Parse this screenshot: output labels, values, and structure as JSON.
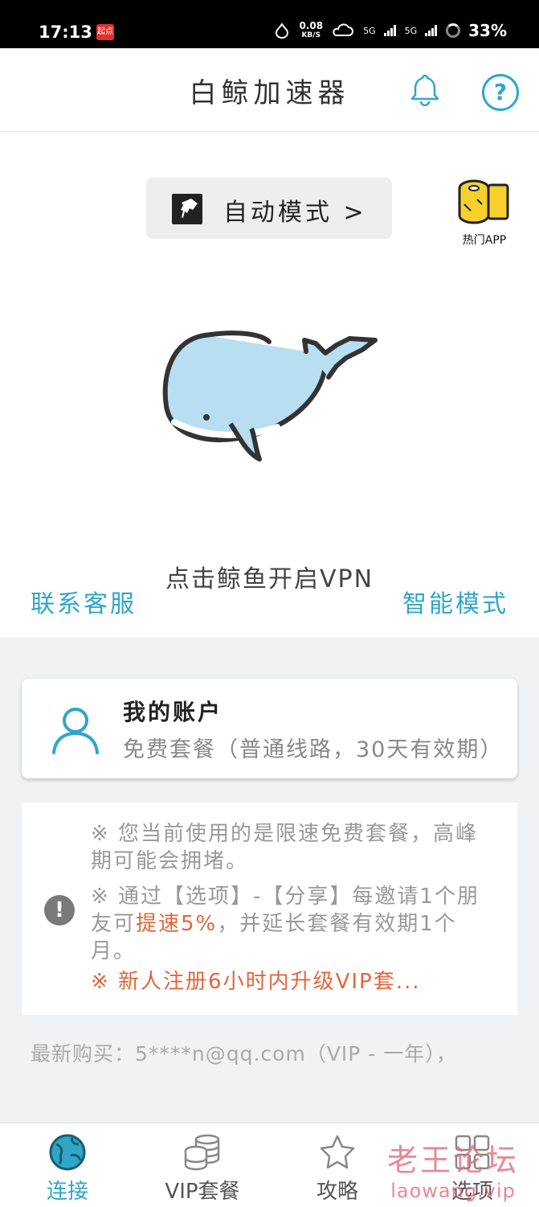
{
  "status_bar": {
    "time": "17:13",
    "app_badge": "起点",
    "net_speed": "0.08",
    "net_unit": "KB/S",
    "signal1": "5G",
    "signal2": "5G",
    "battery": "33%"
  },
  "header": {
    "title": "白鲸加速器"
  },
  "mode_button": {
    "label": "自动模式 >"
  },
  "hot_app": {
    "label": "热门APP"
  },
  "main": {
    "tap_hint": "点击鲸鱼开启VPN",
    "contact_label": "联系客服",
    "smart_mode_label": "智能模式"
  },
  "account": {
    "title": "我的账户",
    "desc": "免费套餐（普通线路，30天有效期）"
  },
  "notice": {
    "line1": "※ 您当前使用的是限速免费套餐，高峰期可能会拥堵。",
    "line2_pre": "※ 通过【选项】-【分享】每邀请1个朋友可",
    "line2_hl": "提速5%",
    "line2_post": "，并延长套餐有效期1个月。",
    "line3": "※ 新人注册6小时内升级VIP套..."
  },
  "latest_purchase": "最新购买：5****n@qq.com（VIP - 一年），",
  "tabs": [
    {
      "label": "连接"
    },
    {
      "label": "VIP套餐"
    },
    {
      "label": "攻略"
    },
    {
      "label": "选项"
    }
  ],
  "watermark": {
    "line1": "老王论坛",
    "line2": "laowang.vip"
  },
  "colors": {
    "accent": "#2fa6c8",
    "highlight": "#e2663a",
    "whale_fill": "#b8def2"
  }
}
